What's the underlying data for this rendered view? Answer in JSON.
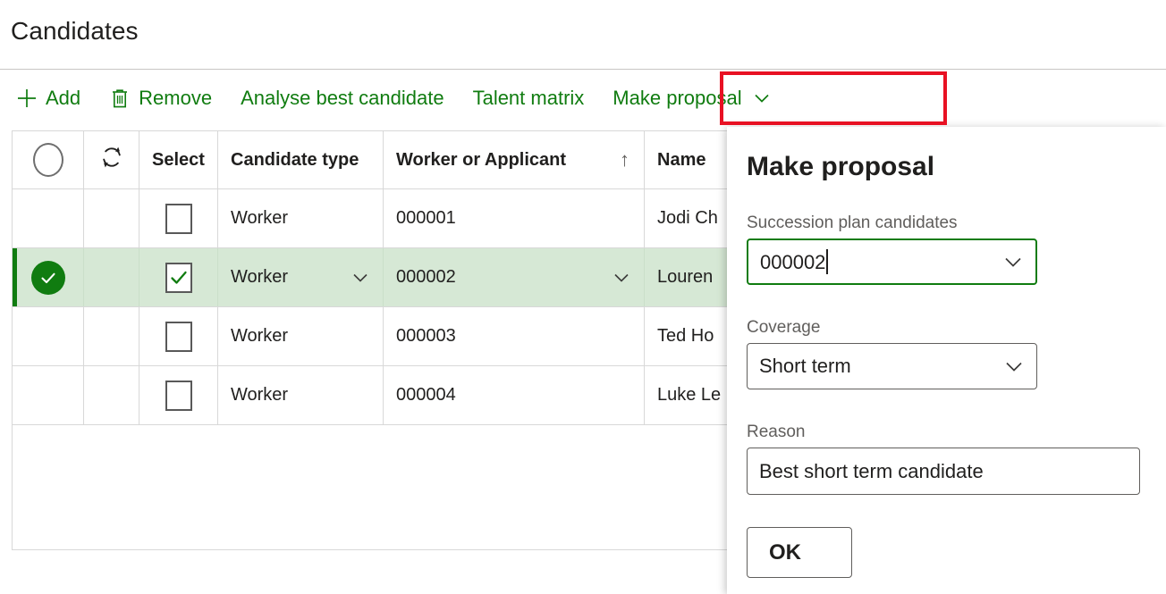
{
  "page": {
    "title": "Candidates"
  },
  "toolbar": {
    "items": [
      {
        "label": "Add",
        "icon": "plus-icon",
        "caret": false
      },
      {
        "label": "Remove",
        "icon": "trash-icon",
        "caret": false
      },
      {
        "label": "Analyse best candidate",
        "icon": null,
        "caret": false
      },
      {
        "label": "Talent matrix",
        "icon": null,
        "caret": false
      },
      {
        "label": "Make proposal",
        "icon": null,
        "caret": true
      }
    ],
    "accent_color": "#107c10",
    "highlight_color": "#e81123"
  },
  "grid": {
    "headers": {
      "status": "",
      "refresh": "",
      "select": "Select",
      "candidate_type": "Candidate type",
      "worker_or_applicant": "Worker or Applicant",
      "sort_indicator": "↑",
      "name": "Name"
    },
    "rows": [
      {
        "selected": false,
        "checked": false,
        "candidate_type": "Worker",
        "worker_or_applicant": "000001",
        "name": "Jodi Ch"
      },
      {
        "selected": true,
        "checked": true,
        "candidate_type": "Worker",
        "worker_or_applicant": "000002",
        "name": "Louren"
      },
      {
        "selected": false,
        "checked": false,
        "candidate_type": "Worker",
        "worker_or_applicant": "000003",
        "name": "Ted Ho"
      },
      {
        "selected": false,
        "checked": false,
        "candidate_type": "Worker",
        "worker_or_applicant": "000004",
        "name": "Luke Le"
      }
    ],
    "selected_row_color": "#d6e8d5",
    "selection_bar_color": "#107c10"
  },
  "dialog": {
    "title": "Make proposal",
    "fields": {
      "succession": {
        "label": "Succession plan candidates",
        "value": "000002",
        "focused": true
      },
      "coverage": {
        "label": "Coverage",
        "value": "Short term",
        "focused": false
      },
      "reason": {
        "label": "Reason",
        "value": "Best short term candidate",
        "focused": false
      }
    },
    "ok_label": "OK"
  }
}
